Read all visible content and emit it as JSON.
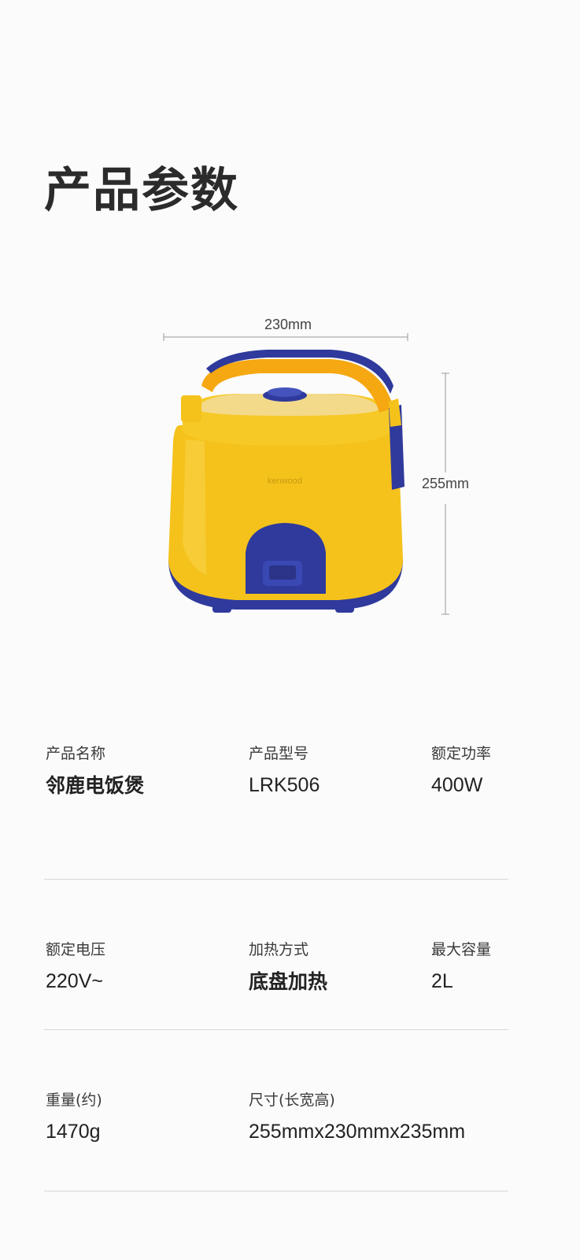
{
  "page": {
    "title": "产品参数"
  },
  "figure": {
    "width_label": "230mm",
    "height_label": "255mm",
    "brand_text": "kenwood",
    "colors": {
      "body_yellow": "#f5c21b",
      "body_yellow_light": "#f8cf2e",
      "accent_blue": "#2f3a9c",
      "lid_top": "#f3d98a"
    }
  },
  "specs": {
    "rows": [
      {
        "cells": [
          {
            "label": "产品名称",
            "value": "邻鹿电饭煲"
          },
          {
            "label": "产品型号",
            "value": "LRK506"
          },
          {
            "label": "额定功率",
            "value": "400W"
          }
        ]
      },
      {
        "cells": [
          {
            "label": "额定电压",
            "value": "220V~"
          },
          {
            "label": "加热方式",
            "value": "底盘加热"
          },
          {
            "label": "最大容量",
            "value": "2L"
          }
        ]
      },
      {
        "cells": [
          {
            "label": "重量(约)",
            "value": "1470g"
          },
          {
            "label": "尺寸(长宽高)",
            "value": "255mmx230mmx235mm"
          }
        ]
      }
    ]
  }
}
